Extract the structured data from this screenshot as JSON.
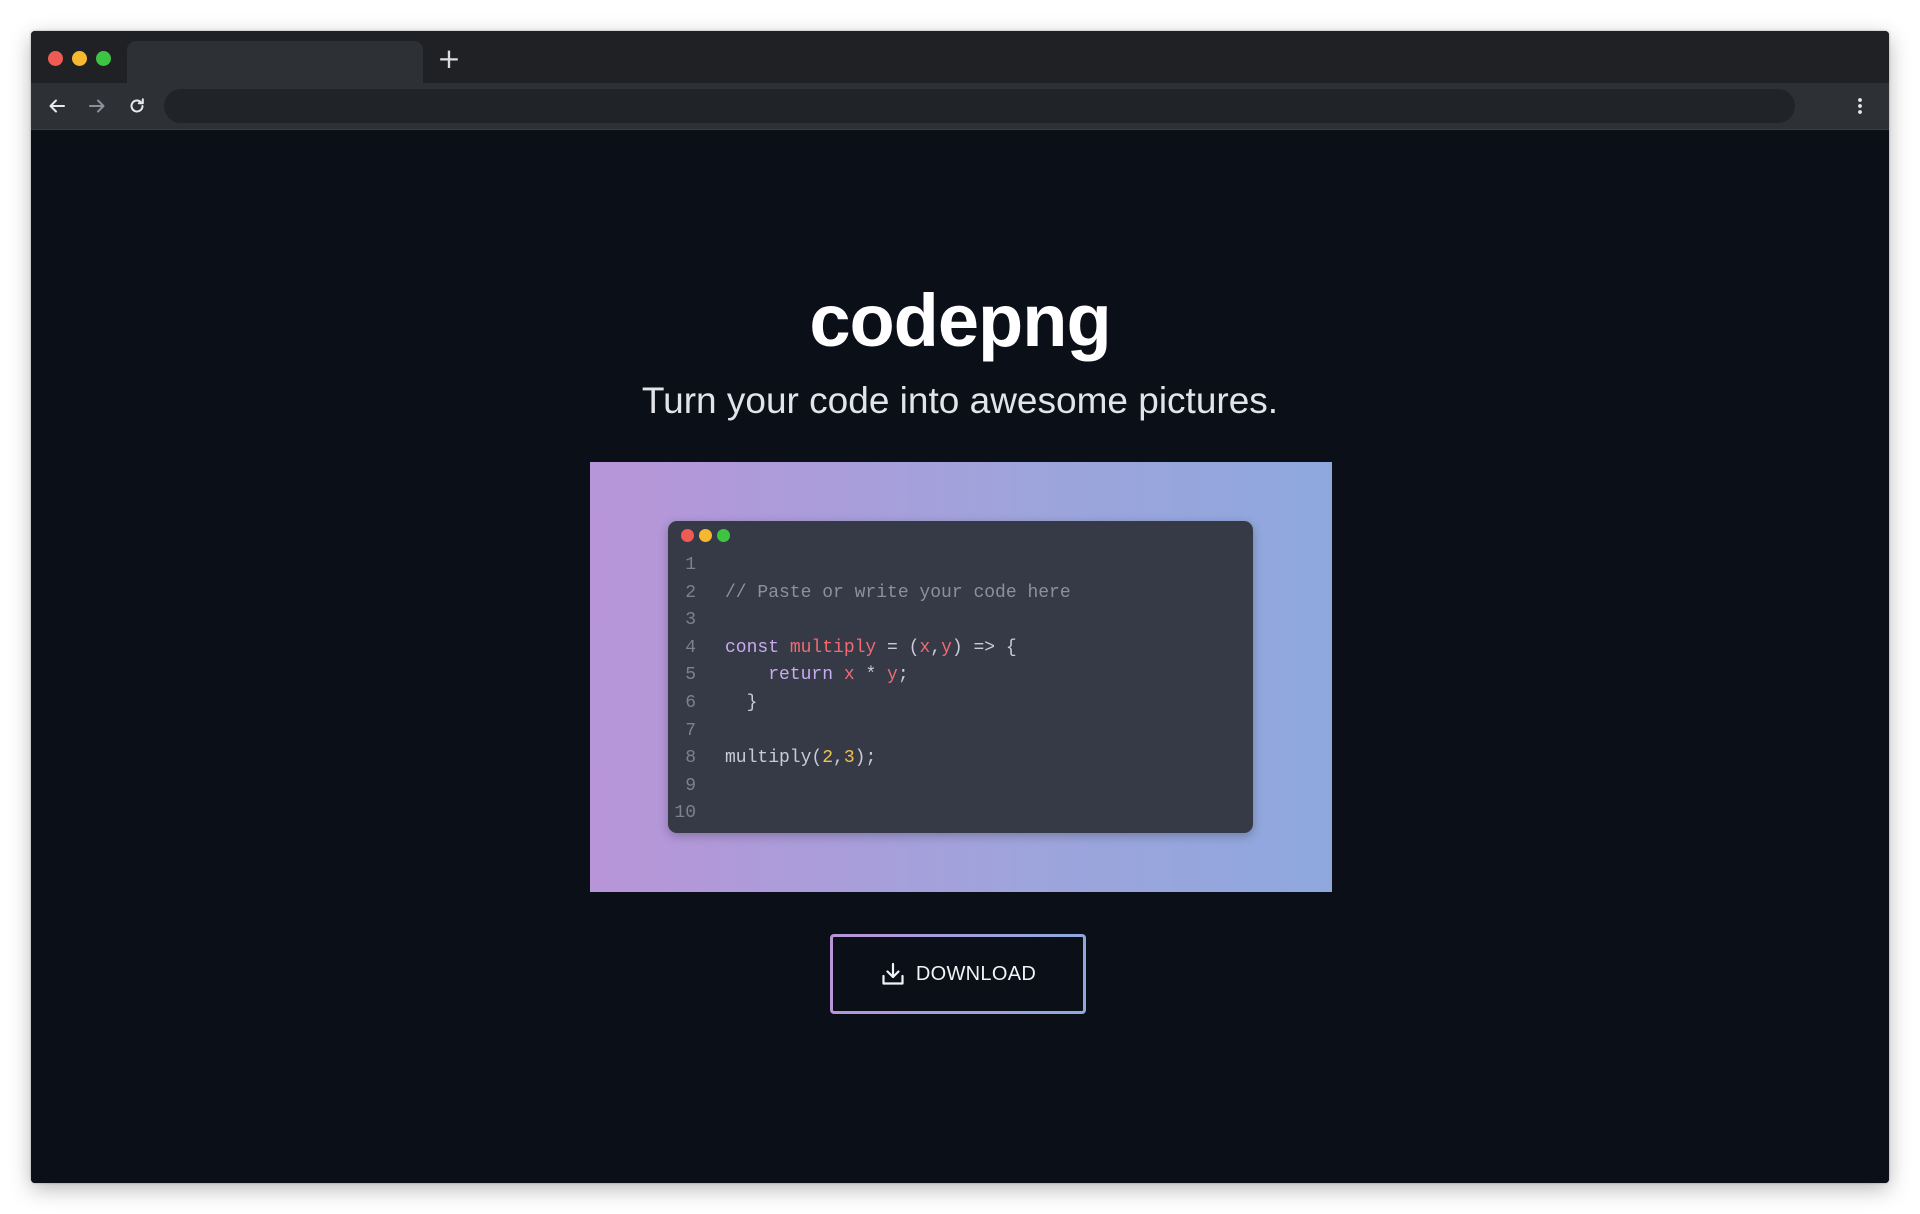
{
  "browser": {
    "traffic_lights": [
      "#ee5b55",
      "#f5b82e",
      "#3dc442"
    ],
    "new_tab_label": "+",
    "active_tab_title": "",
    "address_value": "",
    "chrome_color": "#1f2125",
    "toolbar_color": "#2d3034"
  },
  "header": {
    "title": "codepng",
    "subtitle": "Turn your code into awesome pictures."
  },
  "canvas": {
    "gradient_start": "#b895d8",
    "gradient_end": "#8ea8de",
    "editor_background": "#363a46",
    "editor_dots": [
      "#ee5b55",
      "#f5b82e",
      "#3dc442"
    ]
  },
  "code": {
    "lines": [
      {
        "num": "1",
        "tokens": []
      },
      {
        "num": "2",
        "tokens": [
          {
            "t": "// Paste or write your code here",
            "c": "comment"
          }
        ]
      },
      {
        "num": "3",
        "tokens": []
      },
      {
        "num": "4",
        "tokens": [
          {
            "t": "const ",
            "c": "kw"
          },
          {
            "t": "multiply",
            "c": "fn"
          },
          {
            "t": " = (",
            "c": "plain"
          },
          {
            "t": "x",
            "c": "param"
          },
          {
            "t": ",",
            "c": "plain"
          },
          {
            "t": "y",
            "c": "param"
          },
          {
            "t": ") => {",
            "c": "plain"
          }
        ]
      },
      {
        "num": "5",
        "tokens": [
          {
            "t": "    return ",
            "c": "kw"
          },
          {
            "t": "x",
            "c": "param"
          },
          {
            "t": " * ",
            "c": "plain"
          },
          {
            "t": "y",
            "c": "param"
          },
          {
            "t": ";",
            "c": "plain"
          }
        ]
      },
      {
        "num": "6",
        "tokens": [
          {
            "t": "  }",
            "c": "plain"
          }
        ]
      },
      {
        "num": "7",
        "tokens": []
      },
      {
        "num": "8",
        "tokens": [
          {
            "t": "multiply(",
            "c": "plain"
          },
          {
            "t": "2",
            "c": "num"
          },
          {
            "t": ",",
            "c": "plain"
          },
          {
            "t": "3",
            "c": "num"
          },
          {
            "t": ");",
            "c": "plain"
          }
        ]
      },
      {
        "num": "9",
        "tokens": []
      },
      {
        "num": "10",
        "tokens": []
      }
    ]
  },
  "actions": {
    "download_label": "DOWNLOAD",
    "download_icon": "download-icon"
  }
}
